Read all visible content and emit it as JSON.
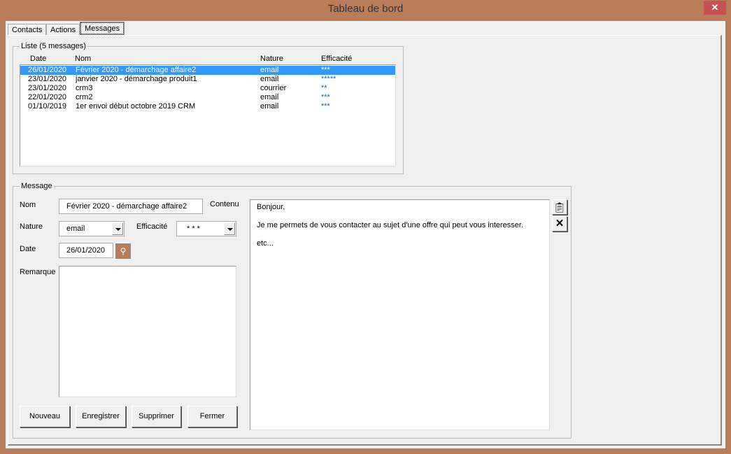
{
  "window": {
    "title": "Tableau de bord",
    "close_icon": "close-icon"
  },
  "tabs": [
    {
      "label": "Contacts"
    },
    {
      "label": "Actions"
    },
    {
      "label": "Messages",
      "active": true
    }
  ],
  "liste": {
    "legend": "Liste (5 messages)",
    "columns": [
      "Date",
      "Nom",
      "Nature",
      "Efficacité"
    ],
    "rows": [
      {
        "date": "26/01/2020",
        "nom": "Février 2020 - démarchage affaire2",
        "nature": "email",
        "efficacite": "***",
        "selected": true
      },
      {
        "date": "23/01/2020",
        "nom": "janvier 2020 - démarchage produit1",
        "nature": "email",
        "efficacite": "*****"
      },
      {
        "date": "23/01/2020",
        "nom": "crm3",
        "nature": "courrier",
        "efficacite": "**"
      },
      {
        "date": "22/01/2020",
        "nom": "crm2",
        "nature": "email",
        "efficacite": "***"
      },
      {
        "date": "01/10/2019",
        "nom": "1er envoi début octobre 2019 CRM",
        "nature": "email",
        "efficacite": "***"
      }
    ],
    "stars_color": "#1f5fb0",
    "selection_color": "#3399ff"
  },
  "message": {
    "legend": "Message",
    "nom_label": "Nom",
    "nom_value": "Février 2020 - démarchage affaire2",
    "contenu_label": "Contenu",
    "contenu_lines": [
      "Bonjour,",
      "Je me permets de vous contacter au sujet d'une offre qui peut vous interesser.",
      "etc..."
    ],
    "nature_label": "Nature",
    "nature_value": "email",
    "efficacite_label": "Efficacité",
    "efficacite_value": "* * *",
    "date_label": "Date",
    "date_value": "26/01/2020",
    "remarque_label": "Remarque",
    "remarque_value": "",
    "buttons": {
      "nouveau": "Nouveau",
      "enregistrer": "Enregistrer",
      "supprimer": "Supprimer",
      "fermer": "Fermer"
    }
  }
}
